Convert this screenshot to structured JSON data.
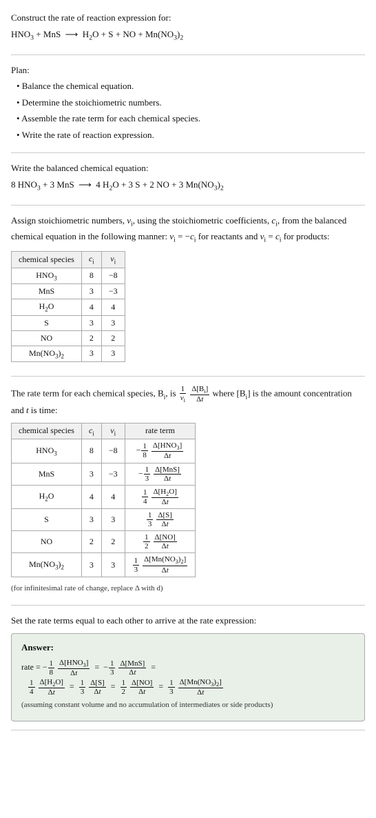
{
  "header": {
    "title": "Construct the rate of reaction expression for:",
    "reaction": "HNO₃ + MnS ⟶ H₂O + S + NO + Mn(NO₃)₂"
  },
  "plan": {
    "label": "Plan:",
    "steps": [
      "• Balance the chemical equation.",
      "• Determine the stoichiometric numbers.",
      "• Assemble the rate term for each chemical species.",
      "• Write the rate of reaction expression."
    ]
  },
  "balanced": {
    "label": "Write the balanced chemical equation:",
    "equation": "8 HNO₃ + 3 MnS ⟶ 4 H₂O + 3 S + 2 NO + 3 Mn(NO₃)₂"
  },
  "stoich_intro": "Assign stoichiometric numbers, νᵢ, using the stoichiometric coefficients, cᵢ, from the balanced chemical equation in the following manner: νᵢ = −cᵢ for reactants and νᵢ = cᵢ for products:",
  "stoich_table": {
    "headers": [
      "chemical species",
      "cᵢ",
      "νᵢ"
    ],
    "rows": [
      [
        "HNO₃",
        "8",
        "−8"
      ],
      [
        "MnS",
        "3",
        "−3"
      ],
      [
        "H₂O",
        "4",
        "4"
      ],
      [
        "S",
        "3",
        "3"
      ],
      [
        "NO",
        "2",
        "2"
      ],
      [
        "Mn(NO₃)₂",
        "3",
        "3"
      ]
    ]
  },
  "rate_term_intro": "The rate term for each chemical species, Bᵢ, is (1/νᵢ)(Δ[Bᵢ]/Δt) where [Bᵢ] is the amount concentration and t is time:",
  "rate_table": {
    "headers": [
      "chemical species",
      "cᵢ",
      "νᵢ",
      "rate term"
    ],
    "rows": [
      [
        "HNO₃",
        "8",
        "−8",
        "−(1/8)(Δ[HNO₃]/Δt)"
      ],
      [
        "MnS",
        "3",
        "−3",
        "−(1/3)(Δ[MnS]/Δt)"
      ],
      [
        "H₂O",
        "4",
        "4",
        "(1/4)(Δ[H₂O]/Δt)"
      ],
      [
        "S",
        "3",
        "3",
        "(1/3)(Δ[S]/Δt)"
      ],
      [
        "NO",
        "2",
        "2",
        "(1/2)(Δ[NO]/Δt)"
      ],
      [
        "Mn(NO₃)₂",
        "3",
        "3",
        "(1/3)(Δ[Mn(NO₃)₂]/Δt)"
      ]
    ]
  },
  "rate_note": "(for infinitesimal rate of change, replace Δ with d)",
  "set_equal_label": "Set the rate terms equal to each other to arrive at the rate expression:",
  "answer": {
    "label": "Answer:",
    "rate_label": "rate ="
  }
}
